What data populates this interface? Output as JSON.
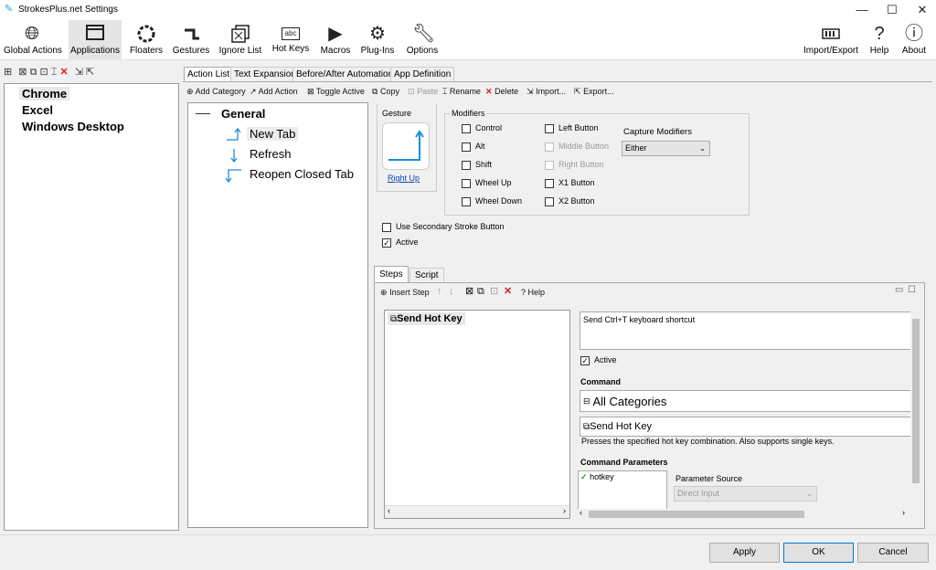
{
  "window": {
    "title": "StrokesPlus.net Settings",
    "minimize": "—",
    "maximize": "☐",
    "close": "✕"
  },
  "toolbar": {
    "global_actions": "Global Actions",
    "applications": "Applications",
    "floaters": "Floaters",
    "gestures": "Gestures",
    "ignore_list": "Ignore List",
    "hot_keys": "Hot Keys",
    "hot_keys_icon_text": "abc",
    "macros": "Macros",
    "plug_ins": "Plug-Ins",
    "options": "Options",
    "import_export": "Import/Export",
    "help": "Help",
    "about": "About"
  },
  "apps": [
    "Chrome",
    "Excel",
    "Windows Desktop"
  ],
  "tabs": [
    "Action List",
    "Text Expansion",
    "Before/After Automation",
    "App Definition"
  ],
  "action_toolbar": {
    "add_category": "Add Category",
    "add_action": "Add Action",
    "toggle_active": "Toggle Active",
    "copy": "Copy",
    "paste": "Paste",
    "rename": "Rename",
    "delete": "Delete",
    "import": "Import...",
    "export": "Export..."
  },
  "tree": {
    "category": "General",
    "actions": [
      "New Tab",
      "Refresh",
      "Reopen Closed Tab"
    ]
  },
  "gesture": {
    "label": "Gesture",
    "name": "Right Up"
  },
  "modifiers": {
    "label": "Modifiers",
    "control": "Control",
    "alt": "Alt",
    "shift": "Shift",
    "wheel_up": "Wheel Up",
    "wheel_down": "Wheel Down",
    "left_button": "Left Button",
    "middle_button": "Middle Button",
    "right_button": "Right Button",
    "x1_button": "X1 Button",
    "x2_button": "X2 Button",
    "capture_label": "Capture Modifiers",
    "capture_value": "Either"
  },
  "options": {
    "secondary": "Use Secondary Stroke Button",
    "active": "Active",
    "active_checked": true
  },
  "step_tabs": [
    "Steps",
    "Script"
  ],
  "steps_toolbar": {
    "insert_step": "Insert Step",
    "help": "Help"
  },
  "steps": [
    "Send Hot Key"
  ],
  "step_detail": {
    "description": "Send Ctrl+T keyboard shortcut",
    "active": "Active",
    "command_label": "Command",
    "category": "All Categories",
    "command": "Send Hot Key",
    "command_desc": "Presses the specified hot key combination. Also supports single keys.",
    "params_label": "Command Parameters",
    "param": "hotkey",
    "param_source_label": "Parameter Source",
    "param_source_value": "Direct Input"
  },
  "footer": {
    "apply": "Apply",
    "ok": "OK",
    "cancel": "Cancel"
  },
  "colors": {
    "accent": "#0078d7",
    "link": "#0645ad",
    "gesture": "#1a8ed8",
    "delete": "#d42020"
  }
}
